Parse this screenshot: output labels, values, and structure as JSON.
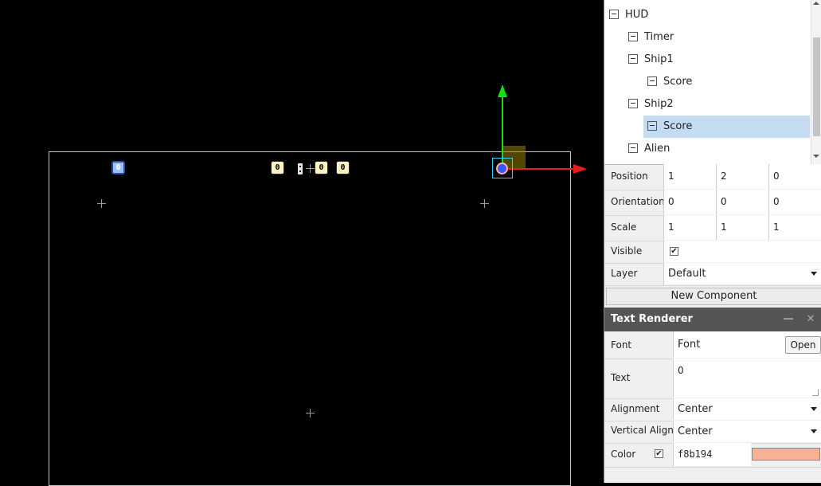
{
  "scene": {
    "hud_glyphs": [
      "0",
      "0",
      "0",
      "0"
    ],
    "selected_color": "#3a58ff"
  },
  "hierarchy": {
    "items": [
      {
        "label": "HUD",
        "depth": 0,
        "selected": false
      },
      {
        "label": "Timer",
        "depth": 1,
        "selected": false
      },
      {
        "label": "Ship1",
        "depth": 1,
        "selected": false
      },
      {
        "label": "Score",
        "depth": 2,
        "selected": false
      },
      {
        "label": "Ship2",
        "depth": 1,
        "selected": false
      },
      {
        "label": "Score",
        "depth": 2,
        "selected": true
      },
      {
        "label": "Alien",
        "depth": 1,
        "selected": false
      }
    ]
  },
  "transform": {
    "position": {
      "label": "Position",
      "values": [
        "1",
        "2",
        "0"
      ]
    },
    "orientation": {
      "label": "Orientation",
      "values": [
        "0",
        "0",
        "0"
      ]
    },
    "scale": {
      "label": "Scale",
      "values": [
        "1",
        "1",
        "1"
      ]
    },
    "visible": {
      "label": "Visible",
      "checked": true
    },
    "layer": {
      "label": "Layer",
      "value": "Default"
    }
  },
  "new_component_label": "New Component",
  "text_renderer": {
    "title": "Text Renderer",
    "minimize_glyph": "—",
    "close_glyph": "✕",
    "font": {
      "label": "Font",
      "value": "Font",
      "button": "Open"
    },
    "text": {
      "label": "Text",
      "value": "0"
    },
    "alignment": {
      "label": "Alignment",
      "value": "Center"
    },
    "vertical_align": {
      "label": "Vertical Align",
      "value": "Center"
    },
    "color": {
      "label": "Color",
      "value": "f8b194",
      "swatch": "#f8b194",
      "enabled": true
    }
  }
}
